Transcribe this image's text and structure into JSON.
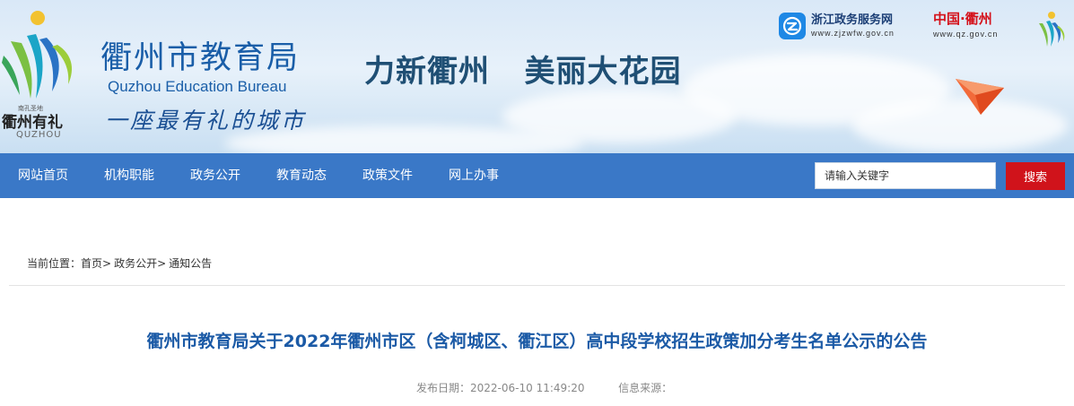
{
  "header": {
    "logo": {
      "small_text": "南孔圣地",
      "city_name": "衢州有礼",
      "latin_name": "QUZHOU"
    },
    "site_name": "衢州市教育局",
    "site_name_en": "Quzhou Education Bureau",
    "slogan": "一座最有礼的城市",
    "motto": "力新衢州   美丽大花园",
    "gov_service": {
      "name": "浙江政务服务网",
      "url": "www.zjzwfw.gov.cn",
      "icon": "zhejiang-gov-service-icon",
      "color": "#1e88e5"
    },
    "city_portal": {
      "name": "中国·衢州",
      "url": "www.qz.gov.cn",
      "color": "#d4121b"
    },
    "brand_color": "#1a5ea8"
  },
  "nav": {
    "items": [
      "网站首页",
      "机构职能",
      "政务公开",
      "教育动态",
      "政策文件",
      "网上办事"
    ],
    "background": "#3a78c7",
    "search": {
      "placeholder": "请输入关键字",
      "button_label": "搜索",
      "button_color": "#d0131b"
    }
  },
  "breadcrumb": {
    "prefix": "当前位置：",
    "items": [
      "首页",
      "政务公开",
      "通知公告"
    ],
    "separator": ">"
  },
  "article": {
    "title": "衢州市教育局关于2022年衢州市区（含柯城区、衢江区）高中段学校招生政策加分考生名单公示的公告",
    "publish_date_label": "发布日期：",
    "publish_date": "2022-06-10 11:49:20",
    "source_label": "信息来源：",
    "source": ""
  }
}
